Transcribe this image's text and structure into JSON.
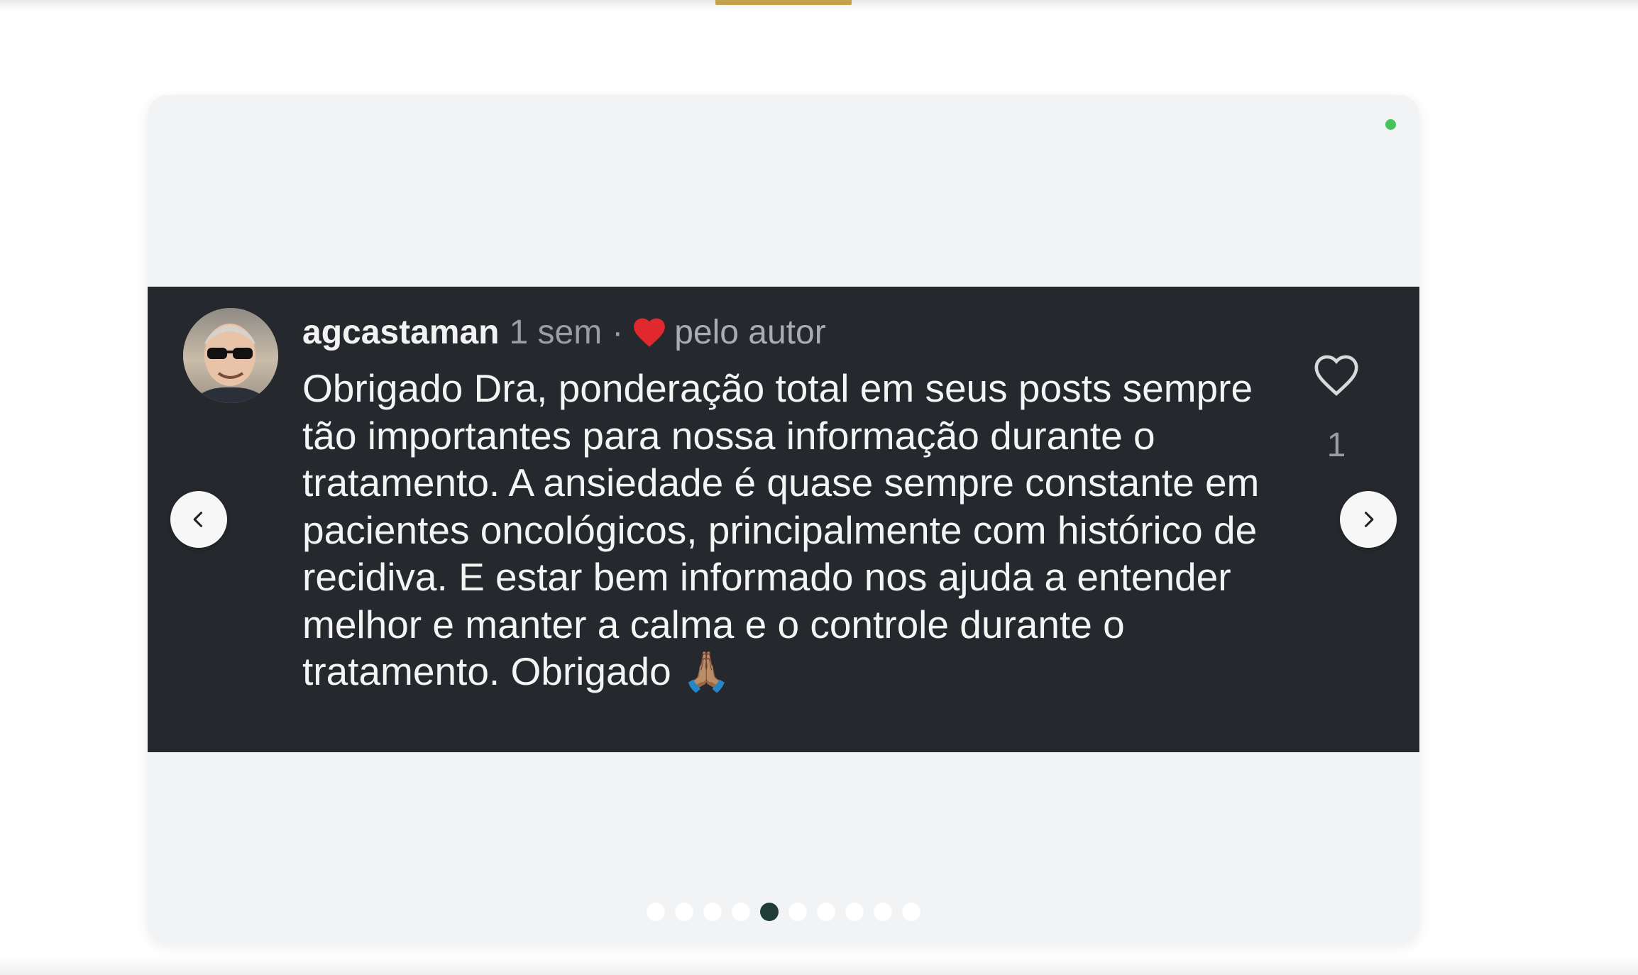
{
  "comment": {
    "username": "agcastaman",
    "time_ago": "1 sem",
    "separator": "·",
    "liked_by_author_label": "pelo autor",
    "text": "Obrigado Dra, ponderação total em seus posts sempre tão importantes para nossa informação durante o tratamento. A ansiedade é quase sempre constante em pacientes oncológicos, principalmente com histórico de recidiva. E estar bem informado nos ajuda a entender melhor e manter a calma e o controle durante o tratamento. Obrigado",
    "emoji": "🙏🏽",
    "like_count": "1"
  },
  "carousel": {
    "total_slides": 10,
    "active_index": 4
  },
  "colors": {
    "accent_bar": "#c2a24d",
    "status_dot": "#45c25a",
    "panel_bg": "#25282c",
    "heart_red": "#e0282e",
    "active_dot": "#1f3d35"
  },
  "icons": {
    "prev": "chevron-left-icon",
    "next": "chevron-right-icon",
    "like": "heart-outline-icon",
    "author_heart": "heart-filled-icon"
  }
}
